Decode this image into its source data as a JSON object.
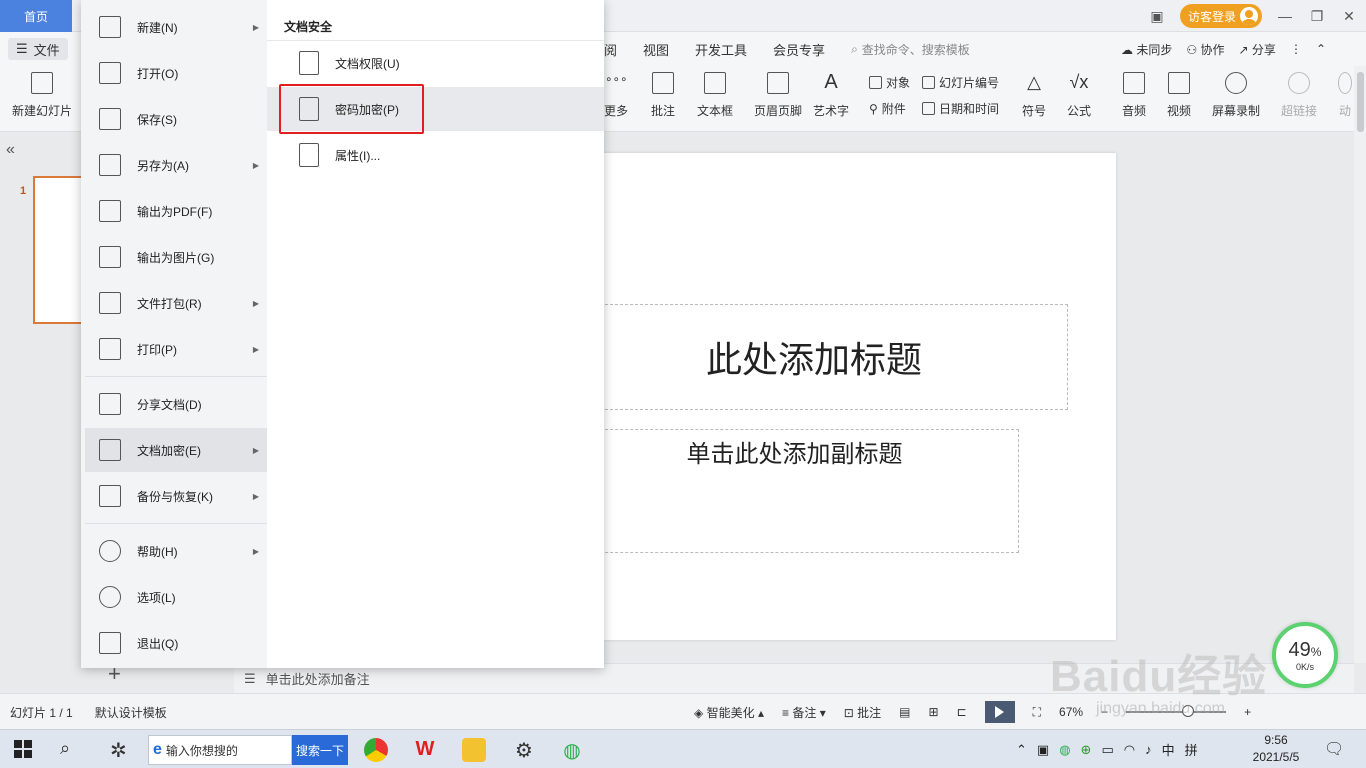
{
  "titlebar": {
    "home_tab": "首页",
    "login_label": "访客登录"
  },
  "menubar": {
    "file_label": "文件",
    "tabs": [
      "阅",
      "视图",
      "开发工具",
      "会员专享"
    ],
    "search_placeholder": "查找命令、搜索模板",
    "sync_label": "未同步",
    "collab_label": "协作",
    "share_label": "分享"
  },
  "ribbon": {
    "new_slide": "新建幻灯片",
    "more": "更多",
    "comment": "批注",
    "textbox": "文本框",
    "header_footer": "页眉页脚",
    "wordart": "艺术字",
    "object": "对象",
    "attachment": "附件",
    "slide_number": "幻灯片编号",
    "datetime": "日期和时间",
    "symbol": "符号",
    "formula": "公式",
    "audio": "音频",
    "video": "视频",
    "screen_record": "屏幕录制",
    "hyperlink": "超链接",
    "animation": "动"
  },
  "file_menu": {
    "items": [
      {
        "label": "新建(N)",
        "icon": "new-file-icon",
        "has_sub": true
      },
      {
        "label": "打开(O)",
        "icon": "folder-open-icon",
        "has_sub": false
      },
      {
        "label": "保存(S)",
        "icon": "save-icon",
        "has_sub": false
      },
      {
        "label": "另存为(A)",
        "icon": "save-as-icon",
        "has_sub": true
      },
      {
        "label": "输出为PDF(F)",
        "icon": "pdf-icon",
        "has_sub": false
      },
      {
        "label": "输出为图片(G)",
        "icon": "image-export-icon",
        "has_sub": false
      },
      {
        "label": "文件打包(R)",
        "icon": "package-icon",
        "has_sub": true
      },
      {
        "label": "打印(P)",
        "icon": "printer-icon",
        "has_sub": true
      },
      {
        "label": "分享文档(D)",
        "icon": "share-icon",
        "has_sub": false
      },
      {
        "label": "文档加密(E)",
        "icon": "encrypt-doc-icon",
        "has_sub": true
      },
      {
        "label": "备份与恢复(K)",
        "icon": "backup-icon",
        "has_sub": true
      },
      {
        "label": "帮助(H)",
        "icon": "help-icon",
        "has_sub": true
      },
      {
        "label": "选项(L)",
        "icon": "gear-icon",
        "has_sub": false
      },
      {
        "label": "退出(Q)",
        "icon": "exit-icon",
        "has_sub": false
      }
    ],
    "submenu_title": "文档安全",
    "submenu_items": [
      {
        "label": "文档权限(U)",
        "icon": "doc-permission-icon"
      },
      {
        "label": "密码加密(P)",
        "icon": "password-lock-icon"
      },
      {
        "label": "属性(I)...",
        "icon": "doc-properties-icon"
      }
    ]
  },
  "slide": {
    "title_placeholder": "此处添加标题",
    "subtitle_placeholder": "单击此处添加副标题",
    "notes_placeholder": "单击此处添加备注",
    "number_label": "1"
  },
  "statusbar": {
    "slide_count": "幻灯片 1 / 1",
    "template": "默认设计模板",
    "beautify": "智能美化",
    "notes": "备注",
    "comment": "批注",
    "zoom": "67%"
  },
  "speed_widget": {
    "percent": "49",
    "percent_sign": "%",
    "rate": "0K/s"
  },
  "watermark": {
    "logo": "Baidu经验",
    "url": "jingyan.baidu.com"
  },
  "taskbar": {
    "search_placeholder": "输入你想搜的",
    "search_button": "搜索一下",
    "ime_lang": "中",
    "ime_mode": "拼",
    "time": "9:56",
    "date": "2021/5/5"
  }
}
